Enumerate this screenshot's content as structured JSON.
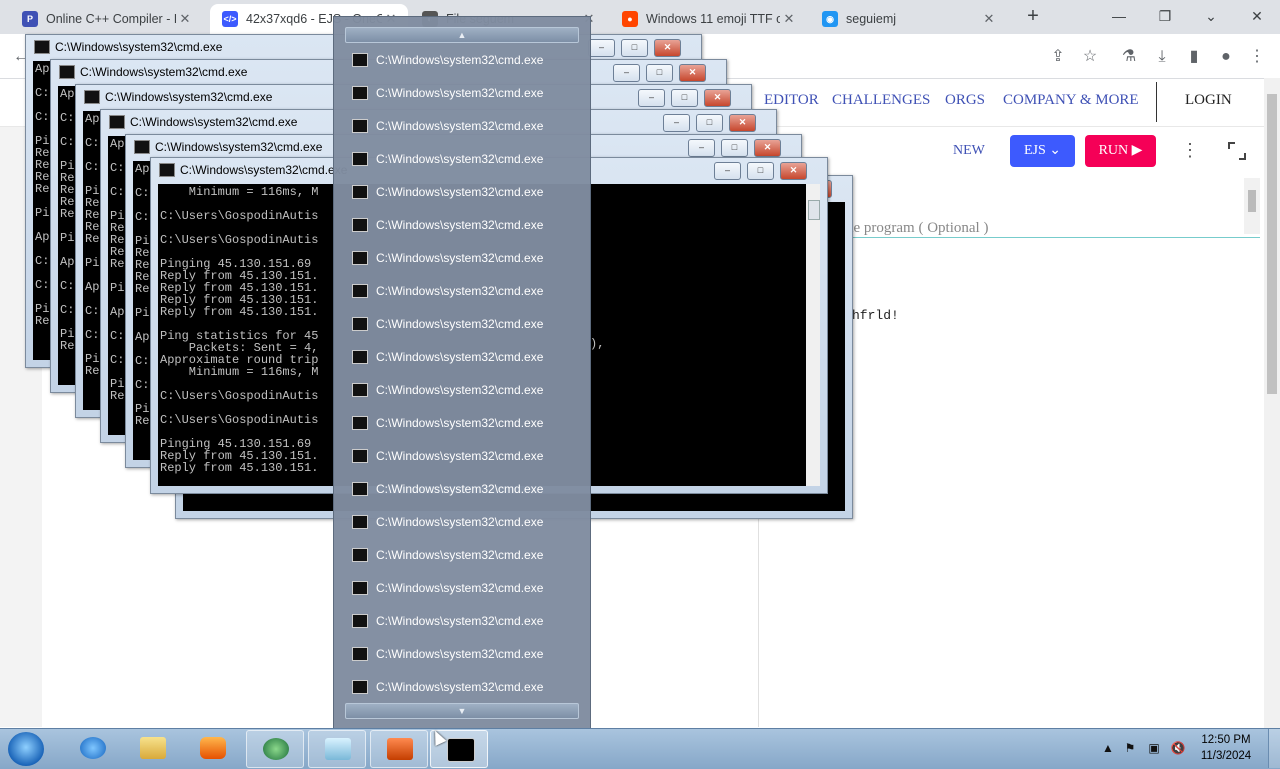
{
  "browser": {
    "tabs": [
      {
        "title": "Online C++ Compiler - P",
        "fav_color": "#3f51b5",
        "fav_glyph": "P",
        "active": false
      },
      {
        "title": "42x37xqd6 - EJS - OneC",
        "fav_color": "#3d5afe",
        "fav_glyph": "</>",
        "active": true
      },
      {
        "title": "File seguem",
        "fav_color": "#555555",
        "fav_glyph": "◐",
        "active": false
      },
      {
        "title": "Windows 11 emoji TTF o",
        "fav_color": "#ff4500",
        "fav_glyph": "●",
        "active": false
      },
      {
        "title": "seguiemj",
        "fav_color": "#2196f3",
        "fav_glyph": "◉",
        "active": false
      }
    ],
    "icons": [
      "back-icon",
      "share-icon",
      "star-icon",
      "extension-icon",
      "download-icon",
      "sidebar-icon",
      "profile-icon",
      "menu-icon",
      "new-tab-icon",
      "minimize-icon",
      "restore-icon",
      "close-icon"
    ]
  },
  "site": {
    "nav": [
      "EDITOR",
      "CHALLENGES",
      "ORGS",
      "COMPANY & MORE"
    ],
    "login": "LOGIN",
    "toolbar": {
      "new": "NEW",
      "ejs": "EJS",
      "run": "RUN"
    },
    "stdin_placeholder": "he program ( Optional )",
    "output": "hfrld!",
    "accent_primary": "#3d5afe",
    "accent_run": "#f50057"
  },
  "cmd": {
    "title": "C:\\Windows\\system32\\cmd.exe",
    "front_lines": [
      "    Minimum = 116ms, M",
      "",
      "C:\\Users\\GospodinAutis",
      "",
      "C:\\Users\\GospodinAutis",
      "",
      "Pinging 45.130.151.69",
      "Reply from 45.130.151.",
      "Reply from 45.130.151.",
      "Reply from 45.130.151.",
      "Reply from 45.130.151.",
      "",
      "Ping statistics for 45",
      "    Packets: Sent = 4,",
      "Approximate round trip",
      "    Minimum = 116ms, M",
      "",
      "C:\\Users\\GospodinAutis",
      "",
      "C:\\Users\\GospodinAutis",
      "",
      "Pinging 45.130.151.69",
      "Reply from 45.130.151.",
      "Reply from 45.130.151."
    ],
    "back_lines": [
      "Ap",
      "",
      "C:",
      "",
      "C:",
      "",
      "Pi",
      "Re",
      "Re",
      "Re",
      "Re",
      "",
      "Pi",
      "",
      "Ap",
      "",
      "C:",
      "",
      "C:",
      "",
      "Pi",
      "Re"
    ],
    "fragment": "),"
  },
  "jumplist": {
    "items": [
      "C:\\Windows\\system32\\cmd.exe",
      "C:\\Windows\\system32\\cmd.exe",
      "C:\\Windows\\system32\\cmd.exe",
      "C:\\Windows\\system32\\cmd.exe",
      "C:\\Windows\\system32\\cmd.exe",
      "C:\\Windows\\system32\\cmd.exe",
      "C:\\Windows\\system32\\cmd.exe",
      "C:\\Windows\\system32\\cmd.exe",
      "C:\\Windows\\system32\\cmd.exe",
      "C:\\Windows\\system32\\cmd.exe",
      "C:\\Windows\\system32\\cmd.exe",
      "C:\\Windows\\system32\\cmd.exe",
      "C:\\Windows\\system32\\cmd.exe",
      "C:\\Windows\\system32\\cmd.exe",
      "C:\\Windows\\system32\\cmd.exe",
      "C:\\Windows\\system32\\cmd.exe",
      "C:\\Windows\\system32\\cmd.exe",
      "C:\\Windows\\system32\\cmd.exe",
      "C:\\Windows\\system32\\cmd.exe",
      "C:\\Windows\\system32\\cmd.exe"
    ]
  },
  "taskbar": {
    "apps": [
      "internet-explorer-icon",
      "file-explorer-icon",
      "media-player-icon",
      "network-globe-icon",
      "notepad-icon",
      "powerpoint-icon",
      "cmd-icon"
    ],
    "clock_time": "12:50 PM",
    "clock_date": "11/3/2024"
  }
}
